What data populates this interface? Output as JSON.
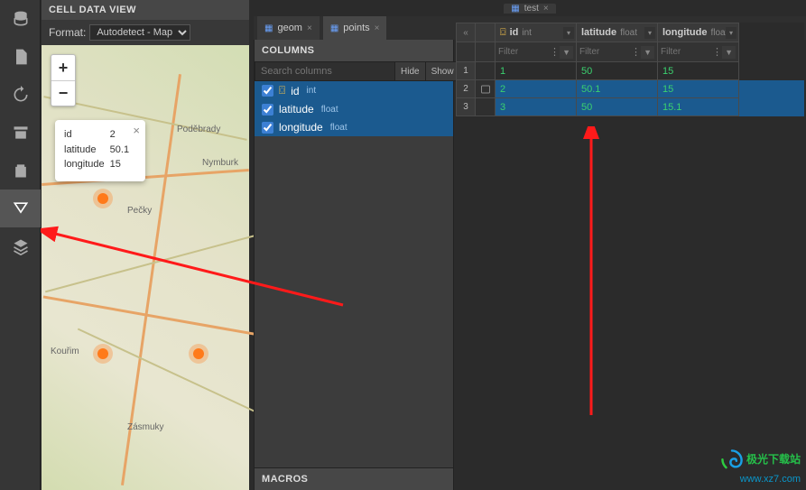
{
  "toolbar_tabs": {
    "workspace_label": "test"
  },
  "db_tabs": [
    {
      "label": "geom",
      "active": false
    },
    {
      "label": "points",
      "active": true
    }
  ],
  "cell_data_view": {
    "title": "CELL DATA VIEW",
    "format_label": "Format:",
    "format_value": "Autodetect - Map",
    "zoom_in": "+",
    "zoom_out": "−",
    "popup": {
      "rows": [
        {
          "k": "id",
          "v": "2"
        },
        {
          "k": "latitude",
          "v": "50.1"
        },
        {
          "k": "longitude",
          "v": "15"
        }
      ]
    },
    "towns": {
      "podebrady": "Poděbrady",
      "nymburk": "Nymburk",
      "pecky": "Pečky",
      "kourim": "Kouřim",
      "zasmuky": "Zásmuky"
    }
  },
  "columns_panel": {
    "title": "COLUMNS",
    "search_placeholder": "Search columns",
    "hide_label": "Hide",
    "show_label": "Show",
    "items": [
      {
        "name": "id",
        "type": "int",
        "checked": true,
        "key": true
      },
      {
        "name": "latitude",
        "type": "float",
        "checked": true,
        "key": false
      },
      {
        "name": "longitude",
        "type": "float",
        "checked": true,
        "key": false
      }
    ],
    "macros_title": "MACROS"
  },
  "grid": {
    "corner_label": "«",
    "columns": [
      {
        "name": "id",
        "type": "int",
        "key": true
      },
      {
        "name": "latitude",
        "type": "float",
        "key": false
      },
      {
        "name": "longitude",
        "type": "float",
        "key": false
      }
    ],
    "filter_placeholder": "Filter",
    "rows": [
      {
        "n": "1",
        "id": "1",
        "latitude": "50",
        "longitude": "15",
        "selected": false
      },
      {
        "n": "2",
        "id": "2",
        "latitude": "50.1",
        "longitude": "15",
        "selected": true
      },
      {
        "n": "3",
        "id": "3",
        "latitude": "50",
        "longitude": "15.1",
        "selected": true
      }
    ]
  },
  "watermark": {
    "line1": "极光下载站",
    "line2": "www.xz7.com"
  }
}
